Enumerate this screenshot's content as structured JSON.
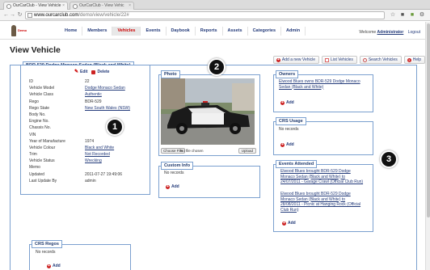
{
  "browser": {
    "tabs": [
      {
        "label": "OurCarClub - View Vehicle",
        "close": "×"
      },
      {
        "label": "OurCarClub - View Vehic",
        "close": "×"
      }
    ],
    "url_host": "www.ourcarclub.com",
    "url_path": "/demo/view/vehicle/22#"
  },
  "header": {
    "logo_text": "Demo",
    "nav": [
      "Home",
      "Members",
      "Vehicles",
      "Events",
      "Daybook",
      "Reports",
      "Assets",
      "Categories",
      "Admin"
    ],
    "active_nav": "Vehicles",
    "welcome_prefix": "Welcome",
    "user": "Administrator",
    "logout": "Logout"
  },
  "page": {
    "title": "View Vehicle",
    "actions": {
      "add": "Add a new Vehicle",
      "list": "List Vehicles",
      "search": "Search Vehicles",
      "help": "Help"
    }
  },
  "vehicle": {
    "panel_title": "BDR-529 Dodge Monaco Sedan (Black and White)",
    "edit": "Edit",
    "delete": "Delete",
    "fields": [
      {
        "label": "ID",
        "value": "22",
        "link": false
      },
      {
        "label": "Vehicle Model",
        "value": "Dodge Monaco Sedan",
        "link": true
      },
      {
        "label": "Vehicle Class",
        "value": "Authentic",
        "link": true
      },
      {
        "label": "Rego",
        "value": "BDR-529",
        "link": false
      },
      {
        "label": "Rego State",
        "value": "New South Wales (NSW)",
        "link": true
      },
      {
        "label": "Body No.",
        "value": "",
        "link": false
      },
      {
        "label": "Engine No.",
        "value": "",
        "link": false
      },
      {
        "label": "Chassis No.",
        "value": "",
        "link": false
      },
      {
        "label": "VIN",
        "value": "",
        "link": false
      },
      {
        "label": "Year of Manufacture",
        "value": "1974",
        "link": false
      },
      {
        "label": "Vehicle Colour",
        "value": "Black and White",
        "link": true
      },
      {
        "label": "Trim",
        "value": "Not Recorded",
        "link": true
      },
      {
        "label": "Vehicle Status",
        "value": "Wrecking",
        "link": true
      },
      {
        "label": "Memo",
        "value": "",
        "link": false
      },
      {
        "label": "Updated",
        "value": "2011-07-27 19:49:06",
        "link": false
      },
      {
        "label": "Last Update By",
        "value": "admin",
        "link": false
      }
    ]
  },
  "photo": {
    "title": "Photo",
    "choose": "Choose File",
    "no_file": "No file chosen",
    "upload": "Upload"
  },
  "custom_info": {
    "title": "Custom Info",
    "empty": "No records",
    "add": "Add"
  },
  "owners": {
    "title": "Owners",
    "link": "Elwood Blues owns BDR-529 Dodge Monaco Sedan (Black and White)",
    "add": "Add"
  },
  "crs_usage": {
    "title": "CRS Usage",
    "empty": "No records",
    "add": "Add"
  },
  "events": {
    "title": "Events Attended",
    "items": [
      "Elwood Blues brought BDR-529 Dodge Monaco Sedan (Black and White) to 24/07/2011 - Garage Crawl (Official Club Run)",
      "Elwood Blues brought BDR-529 Dodge Monaco Sedan (Black and White) to 28/08/2011 - Picnic at Hanging Rock (Official Club Run)"
    ],
    "add": "Add"
  },
  "crs_regos": {
    "title": "CRS Regos",
    "empty": "No records",
    "add": "Add"
  },
  "callouts": [
    "1",
    "2",
    "3"
  ]
}
